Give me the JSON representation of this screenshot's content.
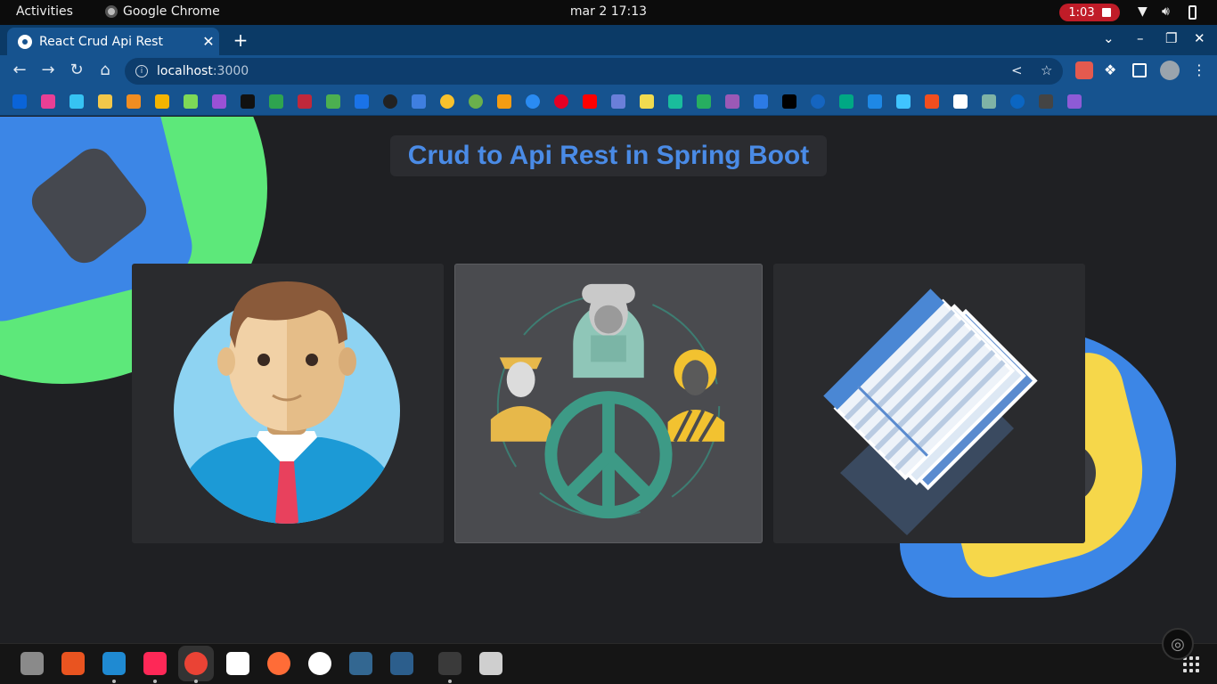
{
  "topbar": {
    "activities": "Activities",
    "app_name": "Google Chrome",
    "clock": "mar 2  17:13",
    "recording_time": "1:03"
  },
  "browser": {
    "tab_title": "React Crud Api Rest",
    "url_host": "localhost",
    "url_port": ":3000"
  },
  "page": {
    "heading": "Crud to Api Rest in Spring Boot",
    "cards": [
      {
        "icon": "user-avatar-illustration"
      },
      {
        "icon": "peace-community-illustration"
      },
      {
        "icon": "documents-stack-illustration"
      }
    ]
  },
  "colors": {
    "heading": "#4a8be6",
    "page_bg": "#1f2023",
    "deco_green": "#5de87a",
    "deco_blue": "#3c86e6",
    "deco_yellow": "#f6d74a",
    "recording": "#c01c28"
  }
}
